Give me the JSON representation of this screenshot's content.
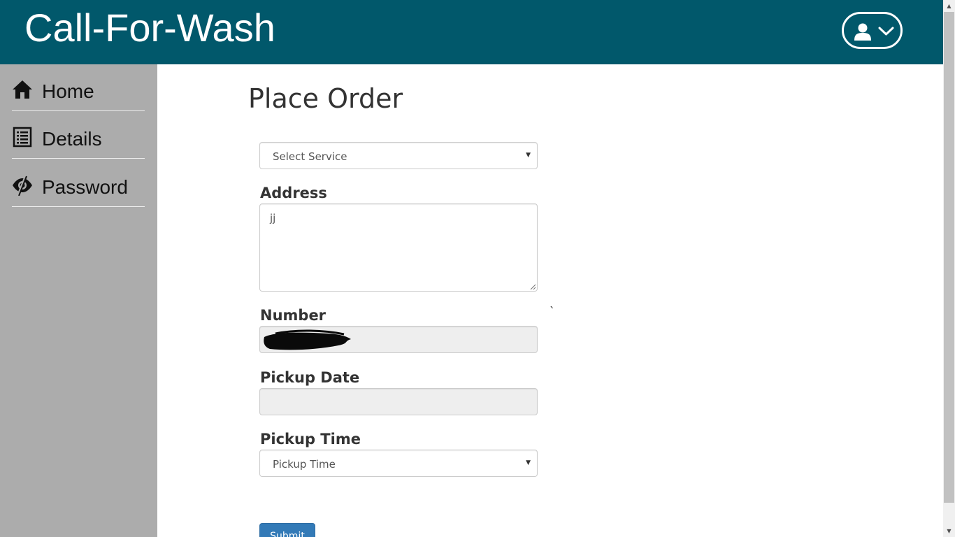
{
  "header": {
    "brand": "Call-For-Wash",
    "user_icon": "user-icon",
    "chevron_icon": "chevron-down-icon",
    "color": "#01586b"
  },
  "sidebar": {
    "color": "#acacac",
    "items": [
      {
        "label": "Home",
        "icon": "home-icon"
      },
      {
        "label": "Details",
        "icon": "list-icon"
      },
      {
        "label": "Password",
        "icon": "eye-slash-icon"
      }
    ]
  },
  "main": {
    "title": "Place Order",
    "service_select": {
      "value": "Select Service"
    },
    "address": {
      "label": "Address",
      "value": "jj"
    },
    "number": {
      "label": "Number",
      "value": ""
    },
    "pickup_date": {
      "label": "Pickup Date",
      "value": ""
    },
    "pickup_time": {
      "label": "Pickup Time",
      "value": "Pickup Time"
    },
    "stray_mark": "`",
    "submit_label": "Submit",
    "submit_color": "#337ab7"
  }
}
